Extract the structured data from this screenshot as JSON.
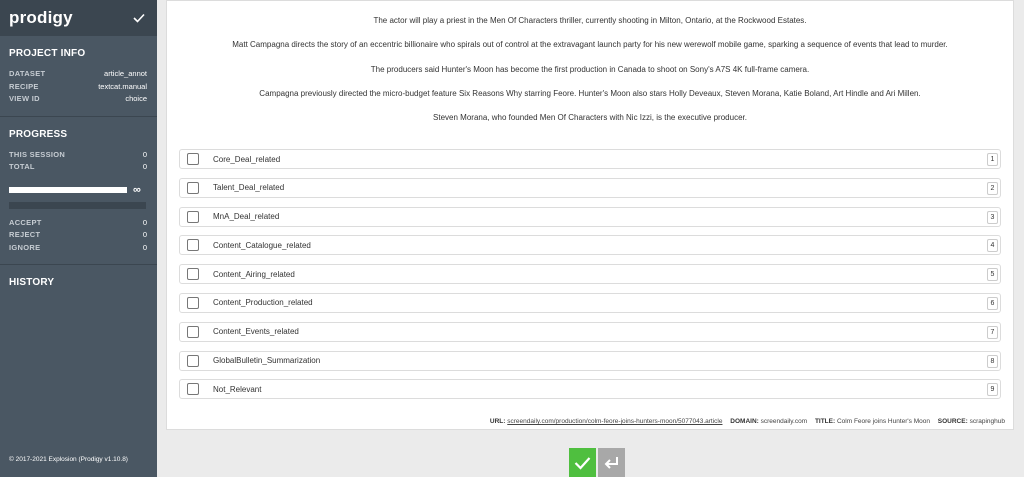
{
  "brand": {
    "name": "prodigy"
  },
  "project_info": {
    "title": "PROJECT INFO",
    "rows": [
      {
        "key": "DATASET",
        "value": "article_annot"
      },
      {
        "key": "RECIPE",
        "value": "textcat.manual"
      },
      {
        "key": "VIEW ID",
        "value": "choice"
      }
    ]
  },
  "progress": {
    "title": "PROGRESS",
    "this_session_label": "THIS SESSION",
    "this_session": "0",
    "total_label": "TOTAL",
    "total": "0",
    "infinity": "∞",
    "accept_label": "ACCEPT",
    "accept": "0",
    "reject_label": "REJECT",
    "reject": "0",
    "ignore_label": "IGNORE",
    "ignore": "0"
  },
  "history": {
    "title": "HISTORY"
  },
  "footer": "© 2017-2021 Explosion   (Prodigy v1.10.8)",
  "text": {
    "paragraphs": [
      "The actor will play a priest in the Men Of Characters thriller, currently shooting in Milton, Ontario, at the Rockwood Estates.",
      "Matt Campagna directs the story of an eccentric billionaire who spirals out of control at the extravagant launch party for his new werewolf mobile game, sparking a sequence of events that lead to murder.",
      "The producers said Hunter's Moon has become the first production in Canada to shoot on Sony's A7S 4K full-frame camera.",
      "Campagna previously directed the micro-budget feature Six Reasons Why starring Feore. Hunter's Moon also stars Holly Deveaux, Steven Morana, Katie Boland, Art Hindle and Ari Millen.",
      "Steven Morana, who founded Men Of Characters with Nic Izzi, is the executive producer."
    ]
  },
  "options": [
    {
      "label": "Core_Deal_related",
      "key": "1"
    },
    {
      "label": "Talent_Deal_related",
      "key": "2"
    },
    {
      "label": "MnA_Deal_related",
      "key": "3"
    },
    {
      "label": "Content_Catalogue_related",
      "key": "4"
    },
    {
      "label": "Content_Airing_related",
      "key": "5"
    },
    {
      "label": "Content_Production_related",
      "key": "6"
    },
    {
      "label": "Content_Events_related",
      "key": "7"
    },
    {
      "label": "GlobalBulletin_Summarization",
      "key": "8"
    },
    {
      "label": "Not_Relevant",
      "key": "9"
    }
  ],
  "meta": {
    "url_label": "URL:",
    "url": "screendaily.com/production/colm-feore-joins-hunters-moon/5077043.article",
    "domain_label": "DOMAIN:",
    "domain": "screendaily.com",
    "title_label": "TITLE:",
    "title": "Colm Feore joins Hunter's Moon",
    "source_label": "SOURCE:",
    "source": "scrapinghub"
  },
  "colors": {
    "sidebar": "#4a5763",
    "brand_bar": "#3b4650",
    "accept": "#4fbf3f",
    "ignore": "#a8a8a8"
  },
  "icons": {
    "brand": "check-icon",
    "accept": "check-icon",
    "ignore": "undo-return-icon"
  }
}
